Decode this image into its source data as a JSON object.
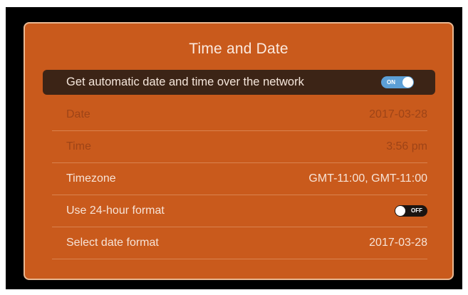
{
  "dialog": {
    "title": "Time and Date"
  },
  "auto_time": {
    "label": "Get automatic date and time over the network",
    "toggle_text": "ON",
    "state": "on"
  },
  "rows": [
    {
      "label": "Date",
      "value": "2017-03-28",
      "enabled": false
    },
    {
      "label": "Time",
      "value": "3:56 pm",
      "enabled": false
    },
    {
      "label": "Timezone",
      "value": "GMT-11:00, GMT-11:00",
      "enabled": true
    },
    {
      "label": "Use 24-hour format",
      "toggle_text": "OFF",
      "state": "off",
      "enabled": true
    },
    {
      "label": "Select date format",
      "value": "2017-03-28",
      "enabled": true
    }
  ],
  "colors": {
    "dialog_bg": "#c95a1c",
    "highlight_bg": "#3c2416",
    "toggle_on": "#5c9fd6",
    "toggle_off": "#1b1410",
    "disabled_text": "#9e4417",
    "enabled_text": "#f7e3d6"
  }
}
